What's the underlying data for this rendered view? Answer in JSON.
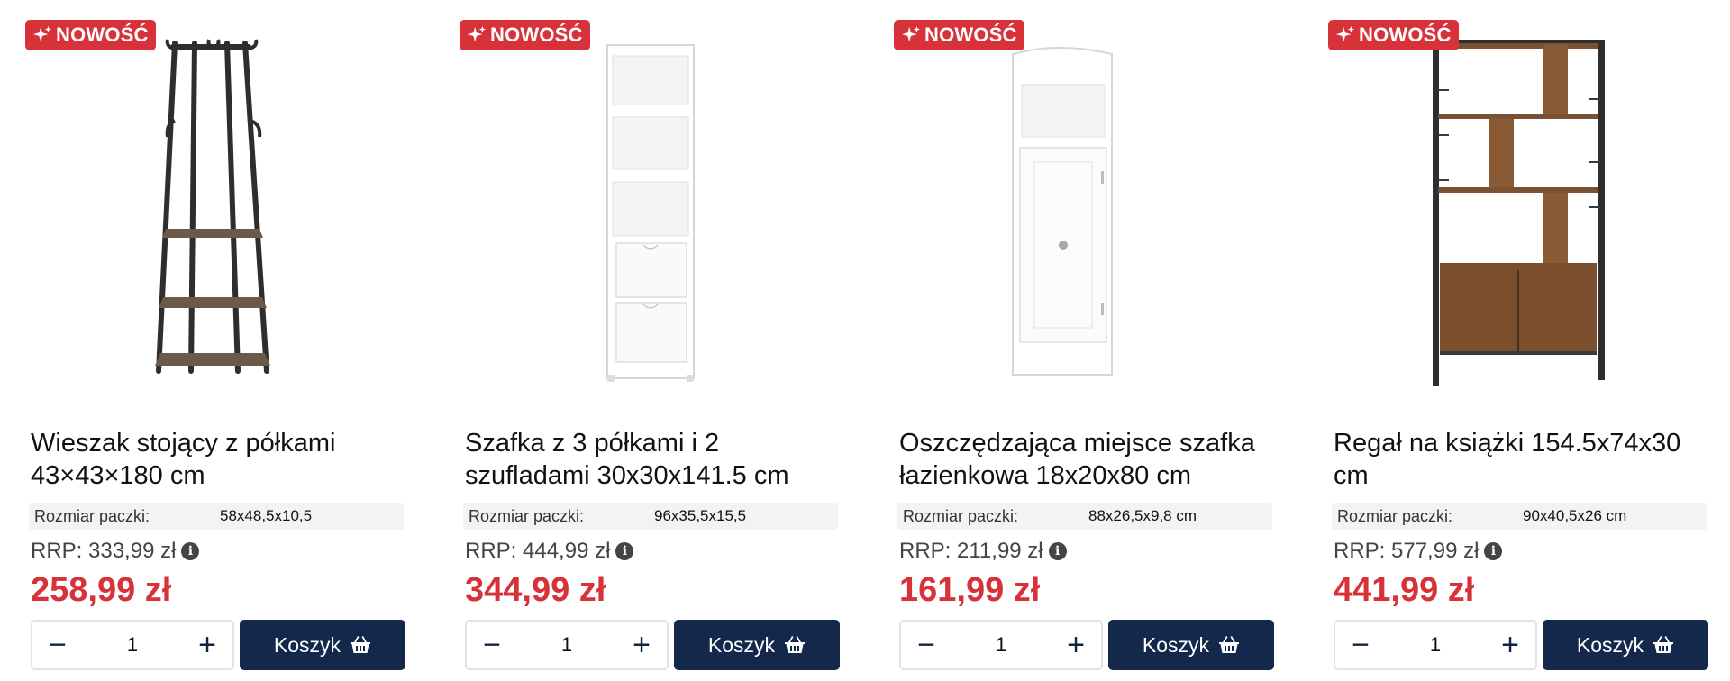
{
  "colors": {
    "badge": "#d7323a",
    "price": "#d7323a",
    "button": "#13284a"
  },
  "products": [
    {
      "badge": "NOWOŚĆ",
      "title": "Wieszak stojący z półkami 43×43×180 cm",
      "package_label": "Rozmiar paczki:",
      "package_value": "58x48,5x10,5",
      "rrp": "RRP: 333,99 zł",
      "price": "258,99 zł",
      "quantity": "1",
      "cart_label": "Koszyk",
      "image_icon": "coat-rack-image"
    },
    {
      "badge": "NOWOŚĆ",
      "title": "Szafka z 3 półkami i 2 szufladami 30x30x141.5 cm",
      "package_label": "Rozmiar paczki:",
      "package_value": "96x35,5x15,5",
      "rrp": "RRP: 444,99 zł",
      "price": "344,99 zł",
      "quantity": "1",
      "cart_label": "Koszyk",
      "image_icon": "white-tall-cabinet-image"
    },
    {
      "badge": "NOWOŚĆ",
      "title": "Oszczędzająca miejsce szafka łazienkowa 18x20x80 cm",
      "package_label": "Rozmiar paczki:",
      "package_value": "88x26,5x9,8 cm",
      "rrp": "RRP: 211,99 zł",
      "price": "161,99 zł",
      "quantity": "1",
      "cart_label": "Koszyk",
      "image_icon": "bathroom-cabinet-image"
    },
    {
      "badge": "NOWOŚĆ",
      "title": "Regał na książki 154.5x74x30 cm",
      "package_label": "Rozmiar paczki:",
      "package_value": "90x40,5x26 cm",
      "rrp": "RRP: 577,99 zł",
      "price": "441,99 zł",
      "quantity": "1",
      "cart_label": "Koszyk",
      "image_icon": "bookshelf-image"
    }
  ]
}
